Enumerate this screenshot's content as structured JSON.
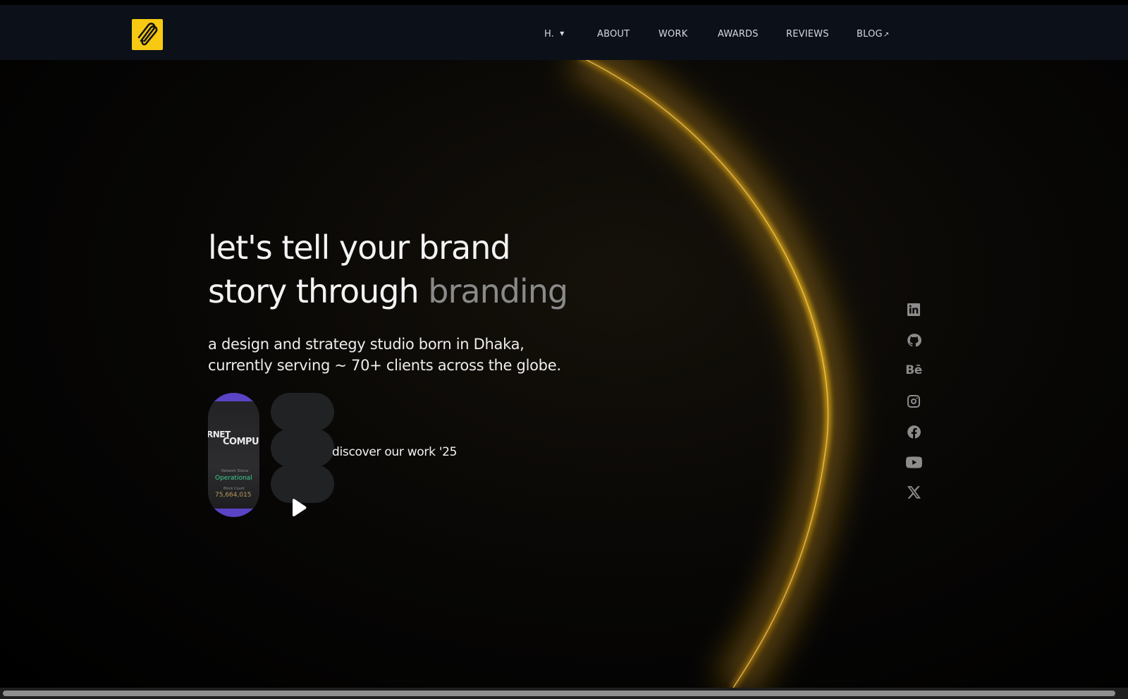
{
  "nav": {
    "logo_icon": "paperclip-icon",
    "logo_color": "#f7c912",
    "items": [
      {
        "label": "H.",
        "has_dropdown": true
      },
      {
        "label": "ABOUT"
      },
      {
        "label": "WORK"
      },
      {
        "label": "AWARDS"
      },
      {
        "label": "REVIEWS"
      },
      {
        "label": "BLOG",
        "external_icon": "↗"
      }
    ]
  },
  "hero": {
    "headline_line1": "let's tell your brand",
    "headline_line2": "story through",
    "headline_highlight": "branding",
    "subtext_line1": "a design and strategy studio born in Dhaka,",
    "subtext_line2": "currently serving ~ 70+ clients across the globe.",
    "showcase": {
      "text_a": "RNET",
      "text_b": "COMPU",
      "status_label": "Network Status",
      "status_value": "Operational",
      "count_label": "Block Count",
      "count_value": "75,664,015"
    },
    "discover_label": "discover our work '25",
    "play_icon": "play-icon"
  },
  "socials": [
    {
      "name": "linkedin-icon"
    },
    {
      "name": "github-icon"
    },
    {
      "name": "behance-icon",
      "glyph": "Bē"
    },
    {
      "name": "instagram-icon"
    },
    {
      "name": "facebook-icon"
    },
    {
      "name": "youtube-icon"
    },
    {
      "name": "x-icon"
    }
  ],
  "colors": {
    "nav_bg": "#0c1019",
    "accent_glow": "#e8a914",
    "muted_text": "#8a8a8a",
    "showcase_accent": "#5a43c4"
  }
}
